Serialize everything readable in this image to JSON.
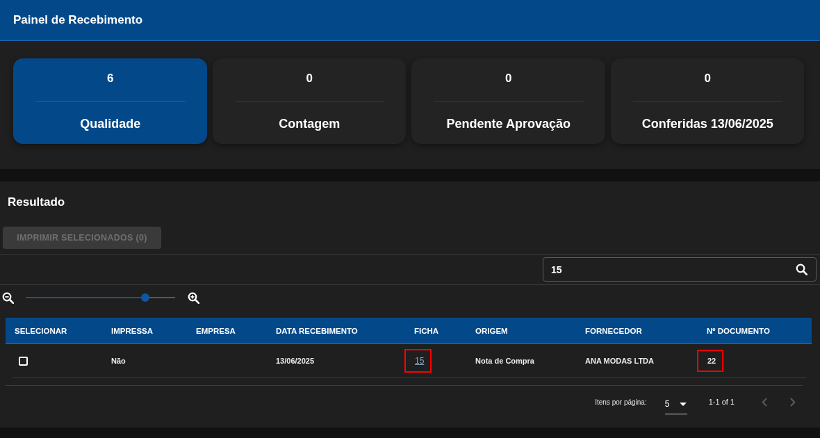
{
  "header": {
    "title": "Painel de Recebimento"
  },
  "summary_cards": [
    {
      "count": "6",
      "label": "Qualidade",
      "selected": true
    },
    {
      "count": "0",
      "label": "Contagem",
      "selected": false
    },
    {
      "count": "0",
      "label": "Pendente Aprovação",
      "selected": false
    },
    {
      "count": "0",
      "label": "Conferidas 13/06/2025",
      "selected": false
    }
  ],
  "results": {
    "title": "Resultado",
    "print_button": {
      "label": "IMPRIMIR SELECIONADOS (0)",
      "disabled": true
    },
    "search": {
      "value": "15"
    },
    "zoom": {
      "level": 0.8
    },
    "table": {
      "columns": [
        "SELECIONAR",
        "IMPRESSA",
        "EMPRESA",
        "DATA RECEBIMENTO",
        "FICHA",
        "ORIGEM",
        "FORNECEDOR",
        "Nº DOCUMENTO"
      ],
      "rows": [
        {
          "cells": [
            {
              "kind": "checkbox",
              "checked": false
            },
            {
              "kind": "text",
              "text": "Não",
              "highlighted": false
            },
            {
              "kind": "blank"
            },
            {
              "kind": "text",
              "text": "13/06/2025",
              "highlighted": false
            },
            {
              "kind": "link",
              "text": "15",
              "highlighted": true
            },
            {
              "kind": "text",
              "text": "Nota de Compra",
              "highlighted": false
            },
            {
              "kind": "text",
              "text": "ANA MODAS LTDA",
              "highlighted": false
            },
            {
              "kind": "text",
              "text": "22",
              "highlighted": true
            }
          ]
        }
      ]
    },
    "paginator": {
      "label": "Itens por página:",
      "page_size": "5",
      "range": "1-1 of 1",
      "previous_disabled": true,
      "next_disabled": true
    }
  }
}
